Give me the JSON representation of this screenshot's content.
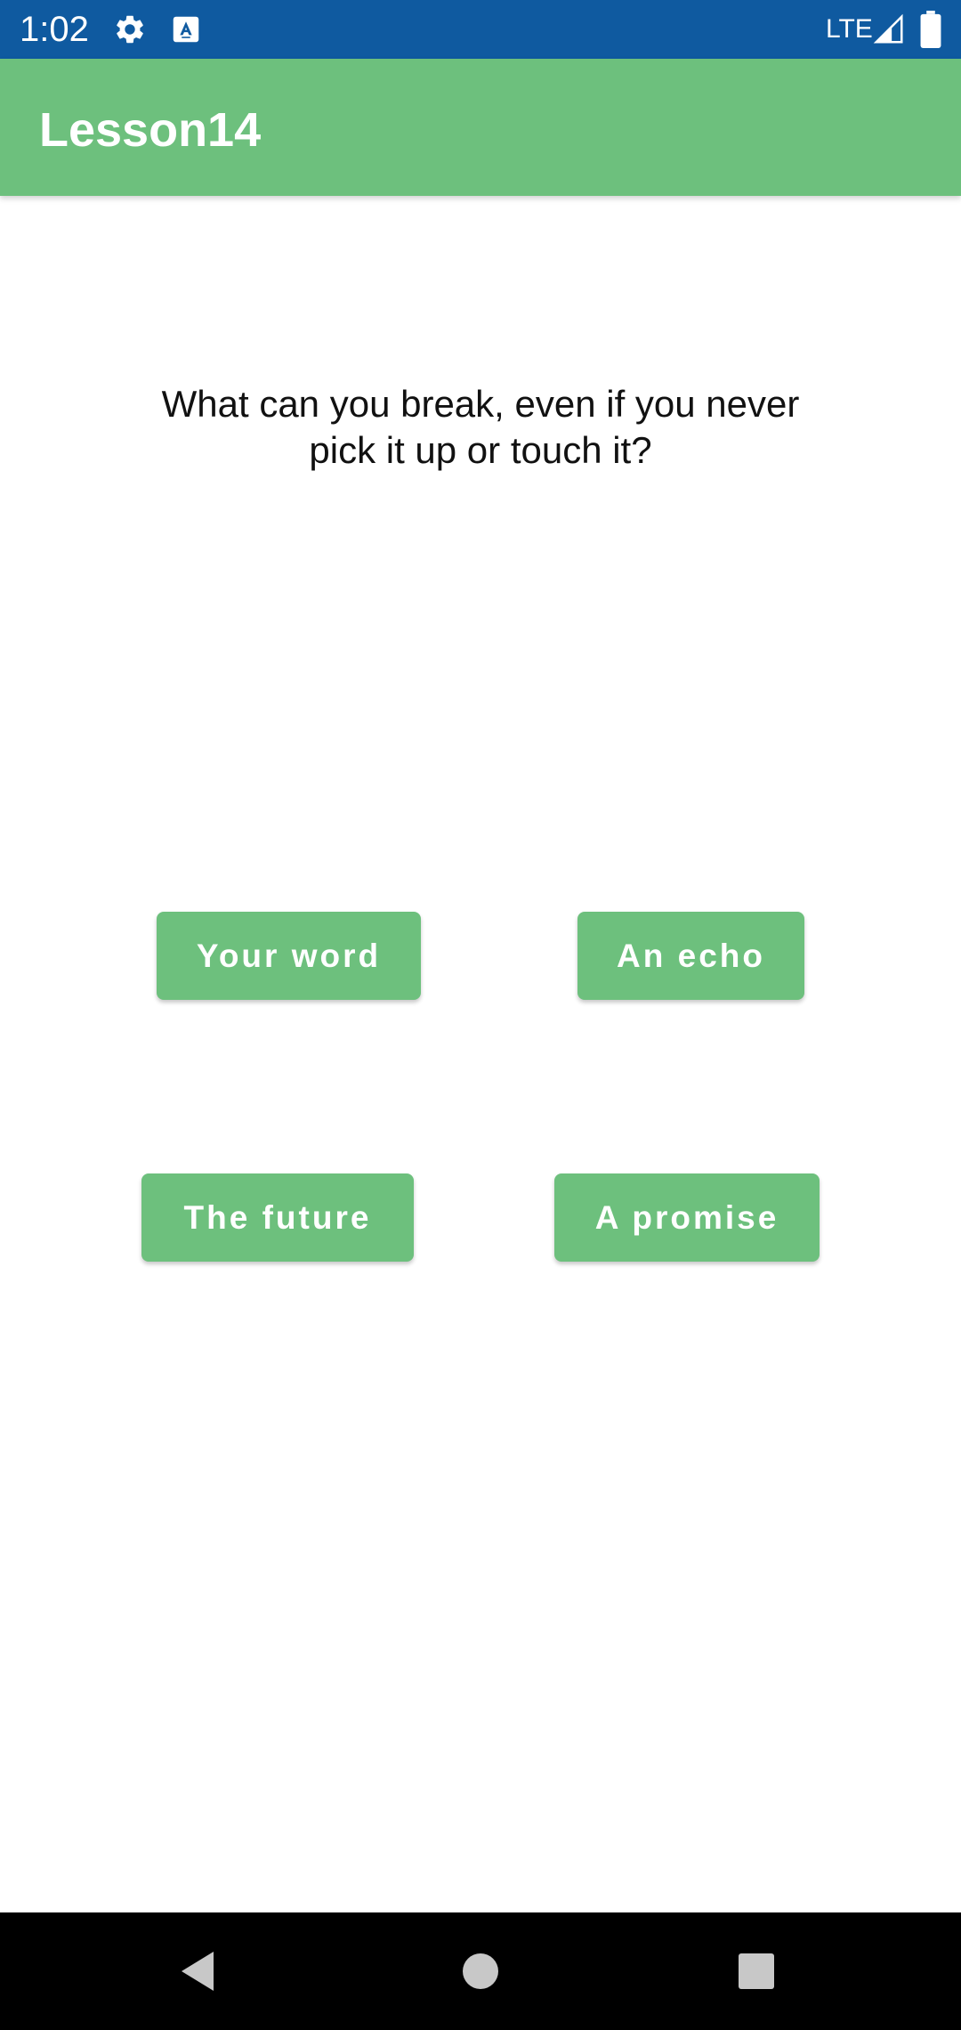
{
  "status_bar": {
    "time": "1:02",
    "network": "LTE",
    "icons": [
      "gear-icon",
      "a-icon",
      "signal-icon",
      "battery-icon"
    ],
    "color": "#0f5aa0"
  },
  "app_bar": {
    "title": "Lesson14",
    "color": "#6dc07d"
  },
  "question": {
    "text": "What can you break, even if you never pick it up or touch it?"
  },
  "answers": [
    {
      "label": "Your word"
    },
    {
      "label": "An echo"
    },
    {
      "label": "The future"
    },
    {
      "label": "A promise"
    }
  ],
  "nav_bar": {
    "icons": [
      "back-icon",
      "home-icon",
      "recents-icon"
    ]
  }
}
